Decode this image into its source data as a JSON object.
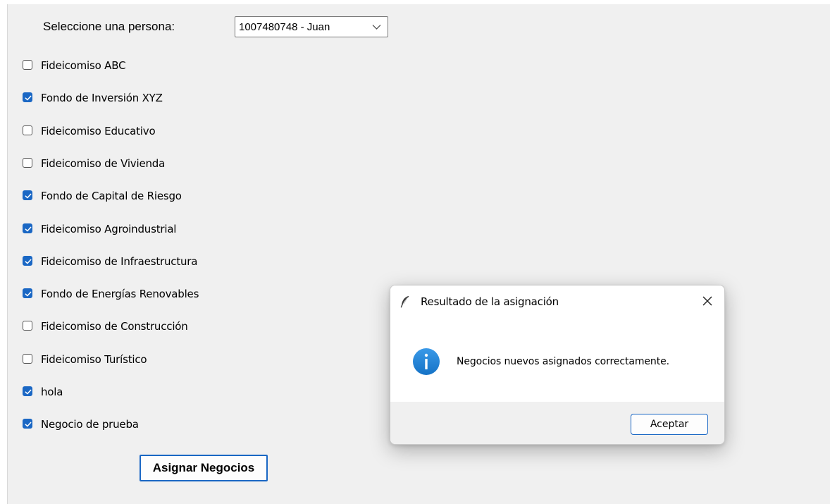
{
  "form": {
    "person_label": "Seleccione una persona:",
    "person_selected": "1007480748 - Juan",
    "assign_button": "Asignar Negocios"
  },
  "businesses": [
    {
      "label": "Fideicomiso ABC",
      "checked": false
    },
    {
      "label": "Fondo de Inversión XYZ",
      "checked": true
    },
    {
      "label": "Fideicomiso Educativo",
      "checked": false
    },
    {
      "label": "Fideicomiso de Vivienda",
      "checked": false
    },
    {
      "label": "Fondo de Capital de Riesgo",
      "checked": true
    },
    {
      "label": "Fideicomiso Agroindustrial",
      "checked": true
    },
    {
      "label": "Fideicomiso de Infraestructura",
      "checked": true
    },
    {
      "label": "Fondo de Energías Renovables",
      "checked": true
    },
    {
      "label": "Fideicomiso de Construcción",
      "checked": false
    },
    {
      "label": "Fideicomiso Turístico",
      "checked": false
    },
    {
      "label": "hola",
      "checked": true
    },
    {
      "label": "Negocio de prueba",
      "checked": true
    }
  ],
  "dialog": {
    "title": "Resultado de la asignación",
    "message": "Negocios nuevos asignados correctamente.",
    "ok_button": "Aceptar",
    "app_icon": "feather-icon",
    "message_icon": "info-icon",
    "close_icon": "close-icon"
  },
  "colors": {
    "accent": "#1a67c4",
    "info_icon": "#1d7fd6",
    "window_bg": "#f0f0f0"
  }
}
